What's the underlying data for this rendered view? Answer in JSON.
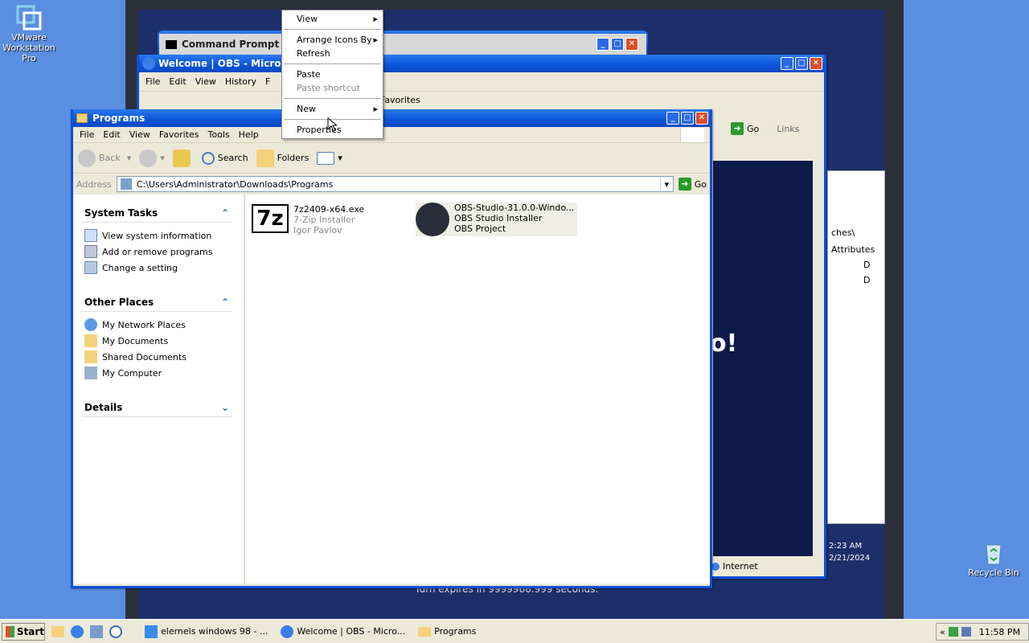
{
  "desktop": {
    "host_icon_vmware": "VMware Workstation Pro",
    "recycle_bin": "Recycle Bin"
  },
  "cmd_window": {
    "title": "Command Prompt"
  },
  "ie_window": {
    "title": "Welcome | OBS - Microsoft",
    "menu": [
      "File",
      "Edit",
      "View",
      "History",
      "F"
    ],
    "go_label": "Go",
    "links_label": "Links",
    "favorites_label": "Favorites",
    "partial_heading": "o!",
    "partial_path": "ches\\",
    "attributes_header": "Attributes",
    "attr_rows": [
      "D",
      "D"
    ],
    "time": "2:23 AM",
    "date": "2/21/2024",
    "zone": "Internet",
    "turn_text": "Turn expires in 9999966.999 seconds."
  },
  "explorer": {
    "title": "Programs",
    "menu": [
      "File",
      "Edit",
      "View",
      "Favorites",
      "Tools",
      "Help"
    ],
    "toolbar": {
      "back": "Back",
      "search": "Search",
      "folders": "Folders"
    },
    "address_label": "Address",
    "address_value": "C:\\Users\\Administrator\\Downloads\\Programs",
    "go_label": "Go",
    "system_tasks": {
      "title": "System Tasks",
      "items": [
        "View system information",
        "Add or remove programs",
        "Change a setting"
      ]
    },
    "other_places": {
      "title": "Other Places",
      "items": [
        "My Network Places",
        "My Documents",
        "Shared Documents",
        "My Computer"
      ]
    },
    "details": {
      "title": "Details"
    },
    "files": [
      {
        "name": "7z2409-x64.exe",
        "desc": "7-Zip Installer",
        "author": "Igor Pavlov",
        "icon": "7zip-icon"
      },
      {
        "name": "OBS-Studio-31.0.0-Windo...",
        "desc": "OBS Studio Installer",
        "author": "OBS Project",
        "icon": "obs-icon"
      }
    ]
  },
  "context_menu": {
    "items": [
      {
        "label": "View",
        "submenu": true,
        "disabled": false
      },
      {
        "label": "Arrange Icons By",
        "submenu": true,
        "disabled": false
      },
      {
        "label": "Refresh",
        "submenu": false,
        "disabled": false
      },
      {
        "label": "Paste",
        "submenu": false,
        "disabled": false
      },
      {
        "label": "Paste shortcut",
        "submenu": false,
        "disabled": true
      },
      {
        "label": "New",
        "submenu": true,
        "disabled": false
      },
      {
        "label": "Properties",
        "submenu": false,
        "disabled": false
      }
    ]
  },
  "taskbar": {
    "start_label": "Start",
    "tasks": [
      "elernels windows 98 - ...",
      "Welcome | OBS - Micro...",
      "Programs"
    ],
    "clock": "11:58 PM"
  },
  "colors": {
    "titlebar": "#0a54d8",
    "desktop": "#5a8ee0",
    "link": "#215dc6"
  }
}
